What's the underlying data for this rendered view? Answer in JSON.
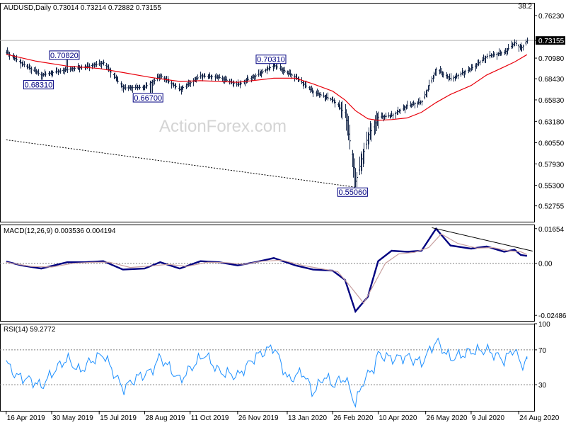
{
  "chart_data": [
    {
      "type": "candlestick",
      "panel": "price",
      "title": "AUDUSD,Daily  0.73014 0.73214 0.72882 0.73155",
      "corner_label": "38.2",
      "ylim": [
        0.508,
        0.778
      ],
      "yticks": [
        "0.76230",
        "0.73155",
        "0.70980",
        "0.68430",
        "0.65830",
        "0.63180",
        "0.60550",
        "0.57930",
        "0.55300",
        "0.52755"
      ],
      "last_price": 0.73155,
      "watermark": "ActionForex.com",
      "moving_average_color": "#e8000b",
      "bar_color": "#1a2b4d",
      "annotations": [
        {
          "label": "0.70820",
          "x": "2019-06-14",
          "value": 0.7082
        },
        {
          "label": "0.68310",
          "x": "2019-05-20",
          "value": 0.6831
        },
        {
          "label": "0.66700",
          "x": "2019-09-03",
          "value": 0.667
        },
        {
          "label": "0.70310",
          "x": "2019-12-31",
          "value": 0.7031
        },
        {
          "label": "0.55060",
          "x": "2020-03-19",
          "value": 0.5506
        }
      ],
      "price_path": [
        {
          "x": "2019-04-16",
          "value": 0.717
        },
        {
          "x": "2019-05-01",
          "value": 0.703
        },
        {
          "x": "2019-05-20",
          "value": 0.689
        },
        {
          "x": "2019-06-14",
          "value": 0.696
        },
        {
          "x": "2019-07-01",
          "value": 0.699
        },
        {
          "x": "2019-07-19",
          "value": 0.704
        },
        {
          "x": "2019-08-07",
          "value": 0.673
        },
        {
          "x": "2019-08-28",
          "value": 0.674
        },
        {
          "x": "2019-09-12",
          "value": 0.688
        },
        {
          "x": "2019-10-01",
          "value": 0.671
        },
        {
          "x": "2019-10-21",
          "value": 0.688
        },
        {
          "x": "2019-11-08",
          "value": 0.686
        },
        {
          "x": "2019-11-26",
          "value": 0.677
        },
        {
          "x": "2019-12-13",
          "value": 0.688
        },
        {
          "x": "2019-12-31",
          "value": 0.701
        },
        {
          "x": "2020-01-21",
          "value": 0.686
        },
        {
          "x": "2020-02-07",
          "value": 0.668
        },
        {
          "x": "2020-02-26",
          "value": 0.658
        },
        {
          "x": "2020-03-09",
          "value": 0.641
        },
        {
          "x": "2020-03-19",
          "value": 0.558
        },
        {
          "x": "2020-03-31",
          "value": 0.613
        },
        {
          "x": "2020-04-10",
          "value": 0.637
        },
        {
          "x": "2020-04-23",
          "value": 0.639
        },
        {
          "x": "2020-05-08",
          "value": 0.651
        },
        {
          "x": "2020-05-22",
          "value": 0.656
        },
        {
          "x": "2020-06-05",
          "value": 0.696
        },
        {
          "x": "2020-06-19",
          "value": 0.684
        },
        {
          "x": "2020-07-09",
          "value": 0.697
        },
        {
          "x": "2020-07-24",
          "value": 0.712
        },
        {
          "x": "2020-08-10",
          "value": 0.717
        },
        {
          "x": "2020-08-20",
          "value": 0.729
        },
        {
          "x": "2020-08-26",
          "value": 0.721
        },
        {
          "x": "2020-09-01",
          "value": 0.732
        }
      ],
      "moving_average": [
        {
          "x": "2019-04-16",
          "value": 0.7145
        },
        {
          "x": "2019-05-15",
          "value": 0.706
        },
        {
          "x": "2019-06-14",
          "value": 0.7
        },
        {
          "x": "2019-07-15",
          "value": 0.697
        },
        {
          "x": "2019-08-07",
          "value": 0.692
        },
        {
          "x": "2019-09-03",
          "value": 0.686
        },
        {
          "x": "2019-10-01",
          "value": 0.681
        },
        {
          "x": "2019-10-21",
          "value": 0.682
        },
        {
          "x": "2019-11-26",
          "value": 0.68
        },
        {
          "x": "2019-12-31",
          "value": 0.685
        },
        {
          "x": "2020-01-21",
          "value": 0.685
        },
        {
          "x": "2020-02-07",
          "value": 0.678
        },
        {
          "x": "2020-02-26",
          "value": 0.669
        },
        {
          "x": "2020-03-09",
          "value": 0.658
        },
        {
          "x": "2020-03-19",
          "value": 0.645
        },
        {
          "x": "2020-03-31",
          "value": 0.635
        },
        {
          "x": "2020-04-10",
          "value": 0.633
        },
        {
          "x": "2020-04-23",
          "value": 0.634
        },
        {
          "x": "2020-05-08",
          "value": 0.636
        },
        {
          "x": "2020-05-22",
          "value": 0.643
        },
        {
          "x": "2020-06-05",
          "value": 0.655
        },
        {
          "x": "2020-06-19",
          "value": 0.665
        },
        {
          "x": "2020-07-09",
          "value": 0.676
        },
        {
          "x": "2020-07-24",
          "value": 0.689
        },
        {
          "x": "2020-08-10",
          "value": 0.699
        },
        {
          "x": "2020-08-20",
          "value": 0.705
        },
        {
          "x": "2020-09-01",
          "value": 0.714
        }
      ],
      "trendline": [
        {
          "x": "2019-04-16",
          "value": 0.609
        },
        {
          "x": "2020-03-19",
          "value": 0.5506
        }
      ]
    },
    {
      "type": "line",
      "panel": "macd",
      "title": "MACD(12,26,9) 0.003536 0.004194",
      "ylim": [
        -0.0275,
        0.0185
      ],
      "yticks": [
        "0.01654",
        "0.00",
        "-0.02486"
      ],
      "zero_line": 0,
      "series": [
        {
          "name": "MACD",
          "color": "#000080",
          "points": [
            {
              "x": "2019-04-16",
              "value": 0.0008
            },
            {
              "x": "2019-05-01",
              "value": -0.001
            },
            {
              "x": "2019-05-20",
              "value": -0.0025
            },
            {
              "x": "2019-06-14",
              "value": 0.0005
            },
            {
              "x": "2019-07-01",
              "value": 0.0005
            },
            {
              "x": "2019-07-19",
              "value": 0.001
            },
            {
              "x": "2019-08-07",
              "value": -0.003
            },
            {
              "x": "2019-08-28",
              "value": -0.0025
            },
            {
              "x": "2019-09-12",
              "value": 0.0005
            },
            {
              "x": "2019-10-01",
              "value": -0.0025
            },
            {
              "x": "2019-10-21",
              "value": 0.001
            },
            {
              "x": "2019-11-08",
              "value": 0.0005
            },
            {
              "x": "2019-11-26",
              "value": -0.001
            },
            {
              "x": "2019-12-13",
              "value": 0.0005
            },
            {
              "x": "2019-12-31",
              "value": 0.0025
            },
            {
              "x": "2020-01-21",
              "value": -0.001
            },
            {
              "x": "2020-02-07",
              "value": -0.003
            },
            {
              "x": "2020-02-26",
              "value": -0.0035
            },
            {
              "x": "2020-03-09",
              "value": -0.008
            },
            {
              "x": "2020-03-19",
              "value": -0.023
            },
            {
              "x": "2020-03-31",
              "value": -0.016
            },
            {
              "x": "2020-04-10",
              "value": 0.001
            },
            {
              "x": "2020-04-23",
              "value": 0.006
            },
            {
              "x": "2020-05-08",
              "value": 0.0055
            },
            {
              "x": "2020-05-22",
              "value": 0.006
            },
            {
              "x": "2020-06-05",
              "value": 0.0165
            },
            {
              "x": "2020-06-19",
              "value": 0.0085
            },
            {
              "x": "2020-07-09",
              "value": 0.007
            },
            {
              "x": "2020-07-24",
              "value": 0.008
            },
            {
              "x": "2020-08-10",
              "value": 0.0055
            },
            {
              "x": "2020-08-20",
              "value": 0.0065
            },
            {
              "x": "2020-08-26",
              "value": 0.004
            },
            {
              "x": "2020-09-01",
              "value": 0.0035
            }
          ]
        },
        {
          "name": "Signal",
          "color": "#c8a0a0",
          "points": [
            {
              "x": "2019-04-16",
              "value": 0.0005
            },
            {
              "x": "2019-05-10",
              "value": -0.0015
            },
            {
              "x": "2019-05-30",
              "value": -0.0018
            },
            {
              "x": "2019-06-20",
              "value": 0.0
            },
            {
              "x": "2019-07-10",
              "value": 0.0005
            },
            {
              "x": "2019-07-25",
              "value": 0.0005
            },
            {
              "x": "2019-08-14",
              "value": -0.002
            },
            {
              "x": "2019-09-05",
              "value": -0.0012
            },
            {
              "x": "2019-09-20",
              "value": -0.0005
            },
            {
              "x": "2019-10-08",
              "value": -0.0015
            },
            {
              "x": "2019-10-28",
              "value": 0.0005
            },
            {
              "x": "2019-11-15",
              "value": 0.0003
            },
            {
              "x": "2019-12-02",
              "value": -0.0005
            },
            {
              "x": "2019-12-20",
              "value": 0.001
            },
            {
              "x": "2020-01-08",
              "value": 0.0015
            },
            {
              "x": "2020-01-28",
              "value": -0.001
            },
            {
              "x": "2020-02-14",
              "value": -0.0025
            },
            {
              "x": "2020-03-02",
              "value": -0.004
            },
            {
              "x": "2020-03-14",
              "value": -0.011
            },
            {
              "x": "2020-03-27",
              "value": -0.019
            },
            {
              "x": "2020-04-06",
              "value": -0.01
            },
            {
              "x": "2020-04-17",
              "value": 0.0
            },
            {
              "x": "2020-04-30",
              "value": 0.0045
            },
            {
              "x": "2020-05-15",
              "value": 0.0052
            },
            {
              "x": "2020-05-29",
              "value": 0.0075
            },
            {
              "x": "2020-06-10",
              "value": 0.014
            },
            {
              "x": "2020-06-26",
              "value": 0.0095
            },
            {
              "x": "2020-07-15",
              "value": 0.0072
            },
            {
              "x": "2020-07-30",
              "value": 0.0075
            },
            {
              "x": "2020-08-14",
              "value": 0.006
            },
            {
              "x": "2020-08-26",
              "value": 0.0055
            },
            {
              "x": "2020-09-01",
              "value": 0.0042
            }
          ]
        }
      ],
      "trendline": [
        {
          "x": "2020-06-01",
          "value": 0.017
        },
        {
          "x": "2020-09-01",
          "value": 0.0058
        }
      ]
    },
    {
      "type": "line",
      "panel": "rsi",
      "title": "RSI(14) 59.2772",
      "ylim": [
        0,
        100
      ],
      "yticks": [
        "100",
        "70",
        "30",
        "0"
      ],
      "levels": [
        70,
        30
      ],
      "series": [
        {
          "name": "RSI",
          "color": "#1e90ff",
          "points": [
            {
              "x": "2019-04-16",
              "value": 55
            },
            {
              "x": "2019-04-26",
              "value": 40
            },
            {
              "x": "2019-05-10",
              "value": 35
            },
            {
              "x": "2019-05-20",
              "value": 28
            },
            {
              "x": "2019-06-03",
              "value": 48
            },
            {
              "x": "2019-06-14",
              "value": 60
            },
            {
              "x": "2019-06-26",
              "value": 45
            },
            {
              "x": "2019-07-08",
              "value": 58
            },
            {
              "x": "2019-07-19",
              "value": 65
            },
            {
              "x": "2019-08-07",
              "value": 25
            },
            {
              "x": "2019-08-20",
              "value": 38
            },
            {
              "x": "2019-09-03",
              "value": 45
            },
            {
              "x": "2019-09-12",
              "value": 62
            },
            {
              "x": "2019-10-01",
              "value": 35
            },
            {
              "x": "2019-10-14",
              "value": 52
            },
            {
              "x": "2019-10-25",
              "value": 65
            },
            {
              "x": "2019-11-08",
              "value": 45
            },
            {
              "x": "2019-11-26",
              "value": 40
            },
            {
              "x": "2019-12-13",
              "value": 62
            },
            {
              "x": "2019-12-31",
              "value": 74
            },
            {
              "x": "2020-01-14",
              "value": 35
            },
            {
              "x": "2020-01-28",
              "value": 45
            },
            {
              "x": "2020-02-07",
              "value": 20
            },
            {
              "x": "2020-02-18",
              "value": 40
            },
            {
              "x": "2020-02-26",
              "value": 30
            },
            {
              "x": "2020-03-09",
              "value": 38
            },
            {
              "x": "2020-03-19",
              "value": 8
            },
            {
              "x": "2020-03-27",
              "value": 35
            },
            {
              "x": "2020-04-06",
              "value": 50
            },
            {
              "x": "2020-04-10",
              "value": 65
            },
            {
              "x": "2020-04-23",
              "value": 60
            },
            {
              "x": "2020-05-08",
              "value": 62
            },
            {
              "x": "2020-05-22",
              "value": 55
            },
            {
              "x": "2020-06-05",
              "value": 80
            },
            {
              "x": "2020-06-19",
              "value": 60
            },
            {
              "x": "2020-07-09",
              "value": 68
            },
            {
              "x": "2020-07-24",
              "value": 70
            },
            {
              "x": "2020-08-10",
              "value": 58
            },
            {
              "x": "2020-08-20",
              "value": 72
            },
            {
              "x": "2020-08-26",
              "value": 52
            },
            {
              "x": "2020-09-01",
              "value": 59.28
            }
          ]
        }
      ]
    }
  ],
  "x_axis": {
    "ticks": [
      {
        "label": "16 Apr 2019",
        "x": "2019-04-16"
      },
      {
        "label": "30 May 2019",
        "x": "2019-05-30"
      },
      {
        "label": "15 Jul 2019",
        "x": "2019-07-15"
      },
      {
        "label": "28 Aug 2019",
        "x": "2019-08-28"
      },
      {
        "label": "11 Oct 2019",
        "x": "2019-10-11"
      },
      {
        "label": "26 Nov 2019",
        "x": "2019-11-26"
      },
      {
        "label": "13 Jan 2020",
        "x": "2020-01-13"
      },
      {
        "label": "26 Feb 2020",
        "x": "2020-02-26"
      },
      {
        "label": "10 Apr 2020",
        "x": "2020-04-10"
      },
      {
        "label": "26 May 2020",
        "x": "2020-05-26"
      },
      {
        "label": "9 Jul 2020",
        "x": "2020-07-09"
      },
      {
        "label": "24 Aug 2020",
        "x": "2020-08-24"
      }
    ]
  }
}
